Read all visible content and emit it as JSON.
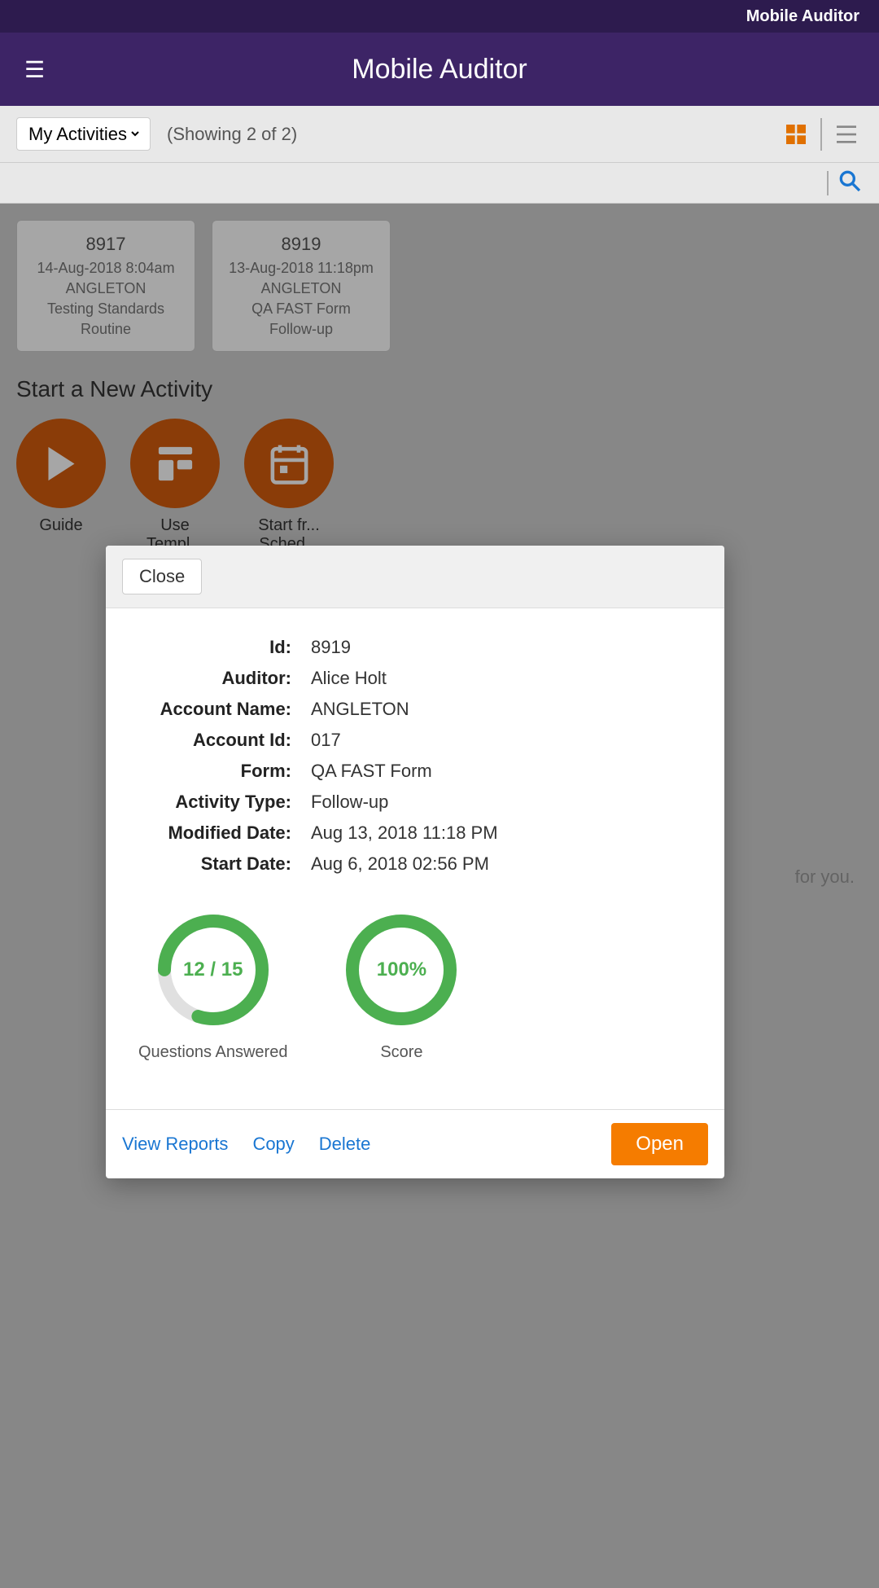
{
  "statusBar": {
    "title": "Mobile Auditor"
  },
  "header": {
    "title": "Mobile Auditor",
    "menuIcon": "☰"
  },
  "toolbar": {
    "activityFilter": "My Activities",
    "showingText": "(Showing 2 of 2)",
    "gridViewIcon": "grid",
    "listViewIcon": "list"
  },
  "cards": [
    {
      "id": "8917",
      "date": "14-Aug-2018 8:04am",
      "name": "ANGLETON",
      "form": "Testing Standards",
      "type": "Routine"
    },
    {
      "id": "8919",
      "date": "13-Aug-2018 11:18pm",
      "name": "ANGLETON",
      "form": "QA FAST Form",
      "type": "Follow-up"
    }
  ],
  "sectionTitle": "Start a New Activity",
  "actionItems": [
    {
      "label": "Guide",
      "icon": "guide"
    },
    {
      "label": "Use\nTempl...",
      "icon": "template"
    },
    {
      "label": "Start fr...\nSched...",
      "icon": "schedule"
    }
  ],
  "bgText": "for you.",
  "modal": {
    "closeLabel": "Close",
    "fields": [
      {
        "label": "Id:",
        "value": "8919"
      },
      {
        "label": "Auditor:",
        "value": "Alice Holt"
      },
      {
        "label": "Account Name:",
        "value": "ANGLETON"
      },
      {
        "label": "Account Id:",
        "value": "017"
      },
      {
        "label": "Form:",
        "value": "QA FAST Form"
      },
      {
        "label": "Activity Type:",
        "value": "Follow-up"
      },
      {
        "label": "Modified Date:",
        "value": "Aug 13, 2018 11:18 PM"
      },
      {
        "label": "Start Date:",
        "value": "Aug 6, 2018 02:56 PM"
      }
    ],
    "questionsAnswered": {
      "value": "12 / 15",
      "percentage": 80,
      "label": "Questions Answered"
    },
    "score": {
      "value": "100%",
      "percentage": 100,
      "label": "Score"
    },
    "viewReportsLabel": "View Reports",
    "copyLabel": "Copy",
    "deleteLabel": "Delete",
    "openLabel": "Open"
  }
}
